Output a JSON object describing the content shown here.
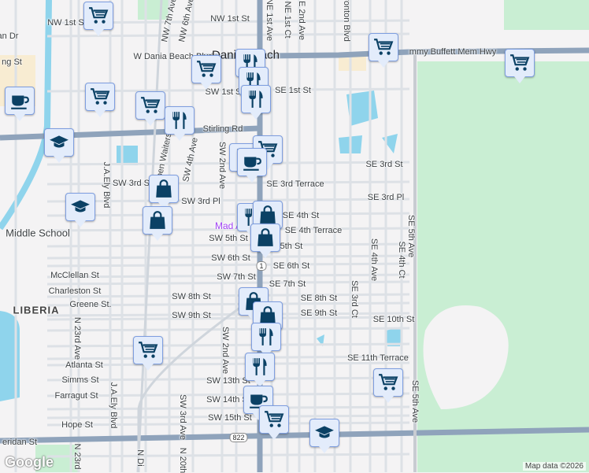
{
  "labels": [
    "NW 1st St",
    "an Dr",
    "NW 7th Ave",
    "NW 6th Ave",
    "NW 1st St",
    "NE 1st Ave",
    "NE 1st Ct",
    "NE 2nd Ave",
    "ronton Blvd",
    "W Dania Beach Blvd",
    "mmy Buffett Mem Hwy",
    "ng St",
    "SW 1st St",
    "SE 1st St",
    "Stirling Rd",
    "J.A.Ely Blvd",
    "Phippen Waiters Rd",
    "SW 4th Ave",
    "SW 2nd Ave",
    "SE 3rd St",
    "SW 3rd St",
    "SE 3rd Terrace",
    "SE 3rd Pl",
    "SW 3rd Pl",
    "SE 4th St",
    "SE 4th Terrace",
    "SW 5th St",
    "5th St",
    "SW 6th St",
    "SE 6th St",
    "SW 7th St",
    "SE 7th St",
    "McClellan St",
    "Charleston St",
    "Greene St.",
    "SW 8th St",
    "SE 8th St",
    "SW 9th St",
    "SE 9th St",
    "SE 10th St",
    "SE 11th Terrace",
    "SE 3rd Ct",
    "SE 4th Ave",
    "SE 4th Ct",
    "SE 5th Ave",
    "SE 5th Ave",
    "N 23rd Ave",
    "Atlanta St",
    "Simms St",
    "Farragut St",
    "Hope St",
    "J.A.Ely Blvd",
    "SW 2nd Ave",
    "SW 3rd Ave",
    "SW 13th St",
    "SW 14th St",
    "SW 15th St",
    "eridan St",
    "N 23rd",
    "N Di",
    "N 20th"
  ],
  "city": "Dania Beach",
  "neighborhood": "LIBERIA",
  "poi": "Mad A",
  "school": "Middle School",
  "shields": {
    "us1": "1",
    "sr822": "822"
  },
  "markers": [
    "cart",
    "cart",
    "cart",
    "cart",
    "restaurant",
    "restaurant",
    "restaurant",
    "coffee",
    "cart",
    "cart",
    "restaurant",
    "restaurant",
    "cart",
    "coffee",
    "school",
    "school",
    "shopping",
    "shopping",
    "restaurant",
    "shopping",
    "shopping",
    "shopping",
    "shopping",
    "restaurant",
    "cart",
    "restaurant",
    "cart",
    "coffee",
    "cart",
    "school"
  ],
  "attribution": "Map data ©2026",
  "logo": "Google",
  "colors": {
    "land": "#f4f3f4",
    "park": "#c9eed3",
    "water": "#8fd4ec",
    "highway": "#8fa3bb",
    "marker_bg": "#e3ecfb",
    "icon": "#0b4165"
  }
}
